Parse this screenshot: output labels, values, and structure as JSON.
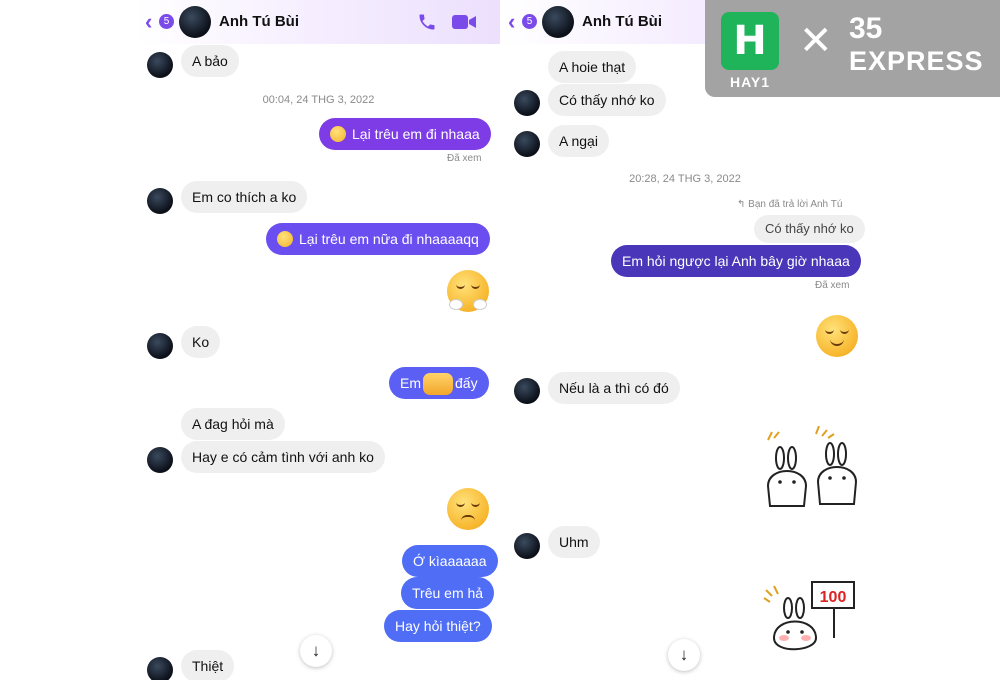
{
  "header": {
    "name": "Anh Tú Bùi",
    "unread": "5"
  },
  "left": {
    "m1": "A bảo",
    "ts1": "00:04, 24 THG 3, 2022",
    "m2": "Lại trêu em đi nhaaa",
    "seen1": "Đã xem",
    "m3": "Em co thích a ko",
    "m4": "Lại trêu em nữa đi nhaaaaqq",
    "m5": "Ko",
    "m6a": "Em",
    "m6b": "đấy",
    "m7": "A đag hỏi mà",
    "m8": "Hay e có cảm tình với anh ko",
    "m9": "Ớ kìaaaaaa",
    "m10": "Trêu em hả",
    "m11": "Hay hỏi thiệt?",
    "m12": "Thiệt"
  },
  "right": {
    "m1": "A hoie thạt",
    "m2": "Có thấy nhớ ko",
    "m3": "A ngại",
    "ts1": "20:28, 24 THG 3, 2022",
    "reply_hint": "Bạn đã trả lời Anh Tú",
    "quoted": "Có thấy nhớ ko",
    "m4": "Em hỏi ngược lại Anh bây giờ nhaaa",
    "seen1": "Đã xem",
    "m5": "Nếu là a thì có đó",
    "m6": "Uhm",
    "sticker_score": "100"
  },
  "watermark": {
    "brand1": "HAY1",
    "brand1_letter": "H",
    "brand2_top": "35",
    "brand2_bottom": "EXPRESS"
  },
  "icons": {
    "back": "chevron-left-icon",
    "call": "phone-icon",
    "video": "video-camera-icon",
    "scroll": "arrow-down-icon"
  },
  "colors": {
    "accent": "#7b4bea",
    "incoming": "#efefef",
    "watermark_bg": "#a3a3a3",
    "hay_green": "#20b45a"
  }
}
